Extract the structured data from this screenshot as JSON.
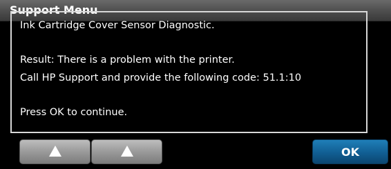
{
  "window": {
    "title": "Support Menu"
  },
  "message": {
    "line1": "Ink Cartridge Cover Sensor Diagnostic.",
    "line2": "Result: There is a problem with the printer.",
    "line3": "Call HP Support and provide the following code: 51.1:10",
    "line4": "Press OK to continue."
  },
  "buttons": {
    "up1_icon": "up-triangle-icon",
    "up2_icon": "up-triangle-icon",
    "ok_label": "OK"
  },
  "colors": {
    "background": "#000000",
    "title_bar": "#4d4d4d",
    "ok_button": "#115e93",
    "nav_button": "#9a9a9a",
    "text": "#ffffff"
  }
}
